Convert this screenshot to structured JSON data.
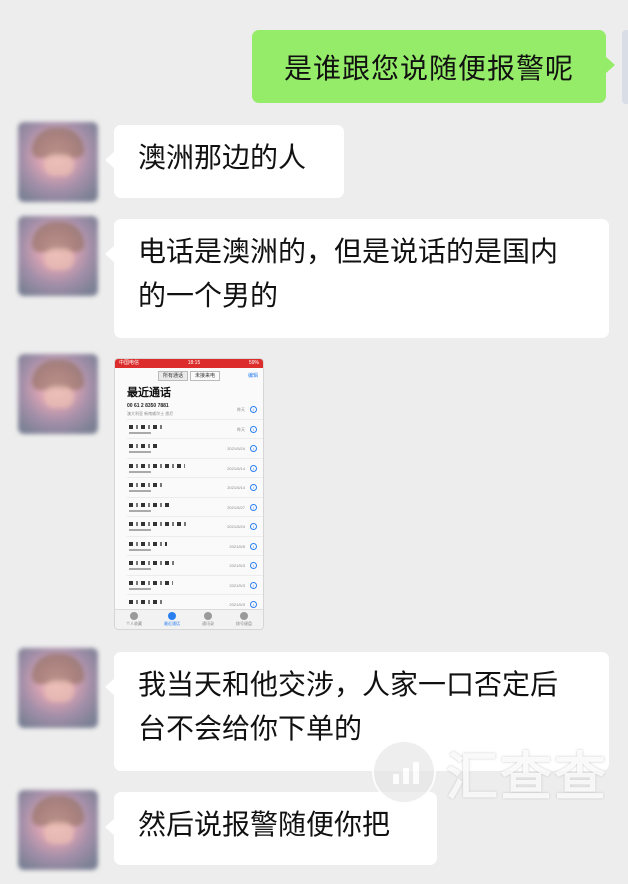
{
  "chat": {
    "outgoing": [
      {
        "text": "是谁跟您说随便报警呢"
      }
    ],
    "incoming": [
      {
        "text": "澳洲那边的人"
      },
      {
        "text": "电话是澳洲的，但是说话的是国内的一个男的"
      },
      {
        "text": "我当天和他交涉，人家一口否定后台不会给你下单的"
      },
      {
        "text": "然后说报警随便你把"
      }
    ],
    "image_message": {
      "status_left": "中国电信",
      "status_time": "18:15",
      "status_right": "59%",
      "segments": [
        "所有通话",
        "未接来电"
      ],
      "edit_label": "编辑",
      "title": "最近通话",
      "first_number": "00 61 2 8350 7881",
      "first_sub": "澳大利亚 新南威尔士 悉尼",
      "dates": [
        "昨天",
        "昨天",
        "2021/5/24",
        "2021/5/14",
        "2021/5/14",
        "2021/5/27",
        "2021/5/24",
        "2021/5/5",
        "2021/5/3",
        "2021/5/3",
        "2021/5/3"
      ],
      "tabs": [
        "个人收藏",
        "最近通话",
        "通讯录",
        "拨号键盘"
      ]
    },
    "watermark": "汇查查"
  }
}
